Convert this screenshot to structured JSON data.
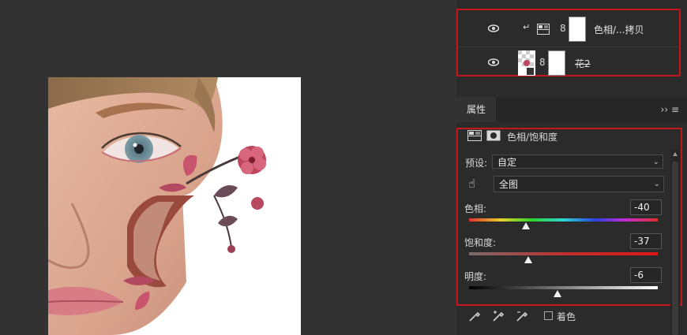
{
  "layers": [
    {
      "name": "色相/...拷贝",
      "visible": true,
      "type": "hue-saturation-adjustment"
    },
    {
      "name": "花2",
      "visible": true,
      "type": "smart-object",
      "struck_through": true
    }
  ],
  "properties_panel": {
    "tab_label": "属性",
    "tab_icons": "›› ≡",
    "adjustment_title": "色相/饱和度",
    "preset_label": "预设:",
    "preset_value": "自定",
    "channel_value": "全图",
    "sliders": [
      {
        "label": "色相:",
        "value": "-40",
        "fraction": 0.3
      },
      {
        "label": "饱和度:",
        "value": "-37",
        "fraction": 0.315
      },
      {
        "label": "明度:",
        "value": "-6",
        "fraction": 0.47
      }
    ],
    "colorize_label": "着色"
  },
  "colors": {
    "panel_bg": "#2b2b2b",
    "app_bg": "#323232",
    "highlight_border": "#c3171a"
  }
}
